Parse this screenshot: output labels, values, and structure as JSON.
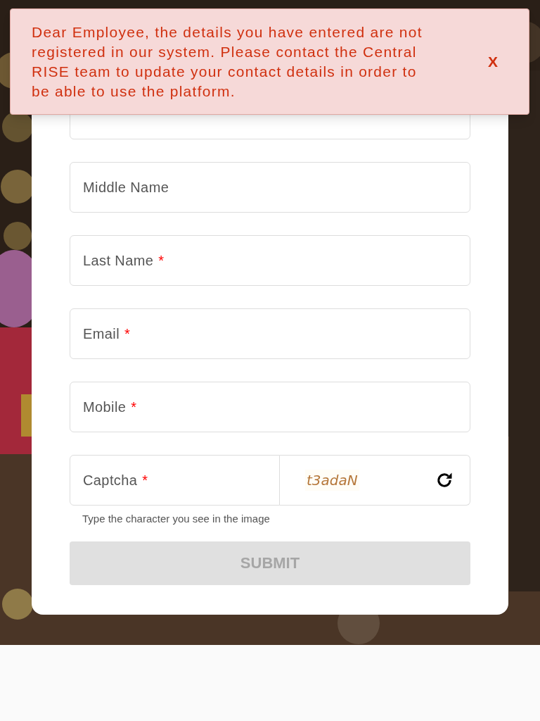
{
  "alert": {
    "message": "Dear Employee, the details you have entered are not registered in our system. Please contact the Central RISE team to update your contact details in order to be able to use the platform.",
    "close": "X"
  },
  "form": {
    "fields": [
      {
        "kind": "covered"
      },
      {
        "kind": "labeled",
        "label": "Middle Name"
      },
      {
        "kind": "labeled",
        "label": "Last Name",
        "required_mark": "*"
      },
      {
        "kind": "labeled",
        "label": "Email",
        "required_mark": "*"
      },
      {
        "kind": "labeled",
        "label": "Mobile",
        "required_mark": "*"
      }
    ],
    "captcha": {
      "label": "Captcha",
      "required_mark": "*",
      "image_text": "t3adaN",
      "hint": "Type the character you see in the image"
    },
    "submit": {
      "label": "SUBMIT",
      "disabled": true
    }
  }
}
